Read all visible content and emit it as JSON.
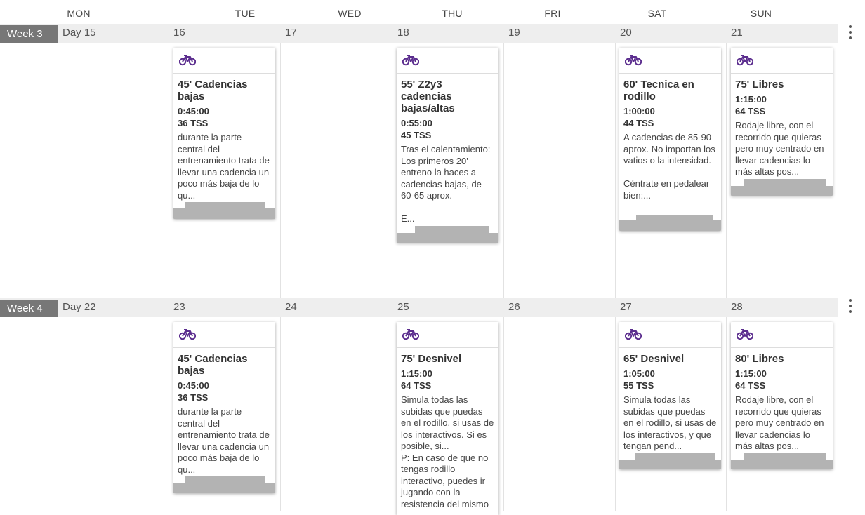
{
  "header": {
    "days": [
      "MON",
      "TUE",
      "WED",
      "THU",
      "FRI",
      "SAT",
      "SUN"
    ]
  },
  "colors": {
    "accent": "#5b2d8e",
    "week_label_bg": "#777777",
    "chart_gray": "#b3b3b3"
  },
  "weeks": [
    {
      "label": "Week 3",
      "days": [
        "Day 15",
        "16",
        "17",
        "18",
        "19",
        "20",
        "21"
      ],
      "workouts": [
        {
          "title": "45' Cadencias bajas",
          "duration": "0:45:00",
          "tss": "36 TSS",
          "desc": "durante la parte central del entrenamiento trata de llevar una cadencia un poco más baja de lo qu...",
          "icon": "bike-icon"
        },
        {
          "title": "55' Z2y3 cadencias bajas/altas",
          "duration": "0:55:00",
          "tss": "45 TSS",
          "desc": "Tras el calentamiento: Los primeros 20' entreno la haces a cadencias bajas, de 60-65 aprox.\n\nE...",
          "icon": "bike-icon"
        },
        {
          "title": "60' Tecnica en rodillo",
          "duration": "1:00:00",
          "tss": "44 TSS",
          "desc": "A cadencias de 85-90 aprox. No importan los vatios o la intensidad.\n\nCéntrate en pedalear bien:...",
          "icon": "bike-icon"
        },
        {
          "title": "75' Libres",
          "duration": "1:15:00",
          "tss": "64 TSS",
          "desc": "Rodaje libre, con el recorrido que quieras pero muy centrado en llevar cadencias lo más altas pos...",
          "icon": "bike-icon"
        }
      ]
    },
    {
      "label": "Week 4",
      "days": [
        "Day 22",
        "23",
        "24",
        "25",
        "26",
        "27",
        "28"
      ],
      "workouts": [
        {
          "title": "45' Cadencias bajas",
          "duration": "0:45:00",
          "tss": "36 TSS",
          "desc": "durante la parte central del entrenamiento trata de llevar una cadencia un poco más baja de lo qu...",
          "icon": "bike-icon"
        },
        {
          "title": "75' Desnivel",
          "duration": "1:15:00",
          "tss": "64 TSS",
          "desc": "Simula todas las subidas que puedas en el rodillo, si usas de los interactivos. Si es posible, si...\nP: En caso de que no tengas rodillo interactivo, puedes ir jugando con la resistencia del mismo",
          "icon": "bike-icon"
        },
        {
          "title": "65' Desnivel",
          "duration": "1:05:00",
          "tss": "55 TSS",
          "desc": "Simula todas las subidas que puedas en el rodillo, si usas de los interactivos, y que tengan pend...",
          "icon": "bike-icon"
        },
        {
          "title": "80' Libres",
          "duration": "1:15:00",
          "tss": "64 TSS",
          "desc": "Rodaje libre, con el recorrido que quieras pero muy centrado en llevar cadencias lo más altas pos...",
          "icon": "bike-icon"
        }
      ]
    }
  ]
}
